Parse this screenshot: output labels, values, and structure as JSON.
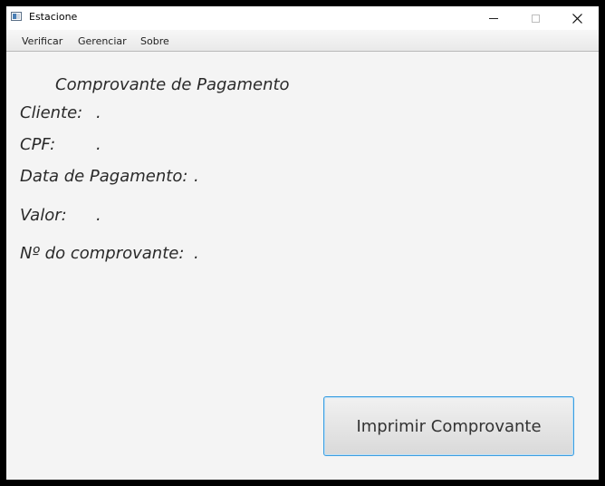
{
  "window": {
    "title": "Estacione"
  },
  "menu": {
    "items": [
      "Verificar",
      "Gerenciar",
      "Sobre"
    ]
  },
  "receipt": {
    "heading": "Comprovante de Pagamento",
    "fields": [
      {
        "label": "Cliente:",
        "value": "."
      },
      {
        "label": "CPF:",
        "value": "."
      },
      {
        "label": "Data de Pagamento:",
        "value": "."
      },
      {
        "label": "Valor:",
        "value": "."
      },
      {
        "label": "Nº do comprovante:",
        "value": "."
      }
    ]
  },
  "actions": {
    "print_label": "Imprimir Comprovante"
  },
  "colors": {
    "background": "#f4f4f4",
    "button_border": "#3c9ee0",
    "text": "#2a2a2a"
  }
}
